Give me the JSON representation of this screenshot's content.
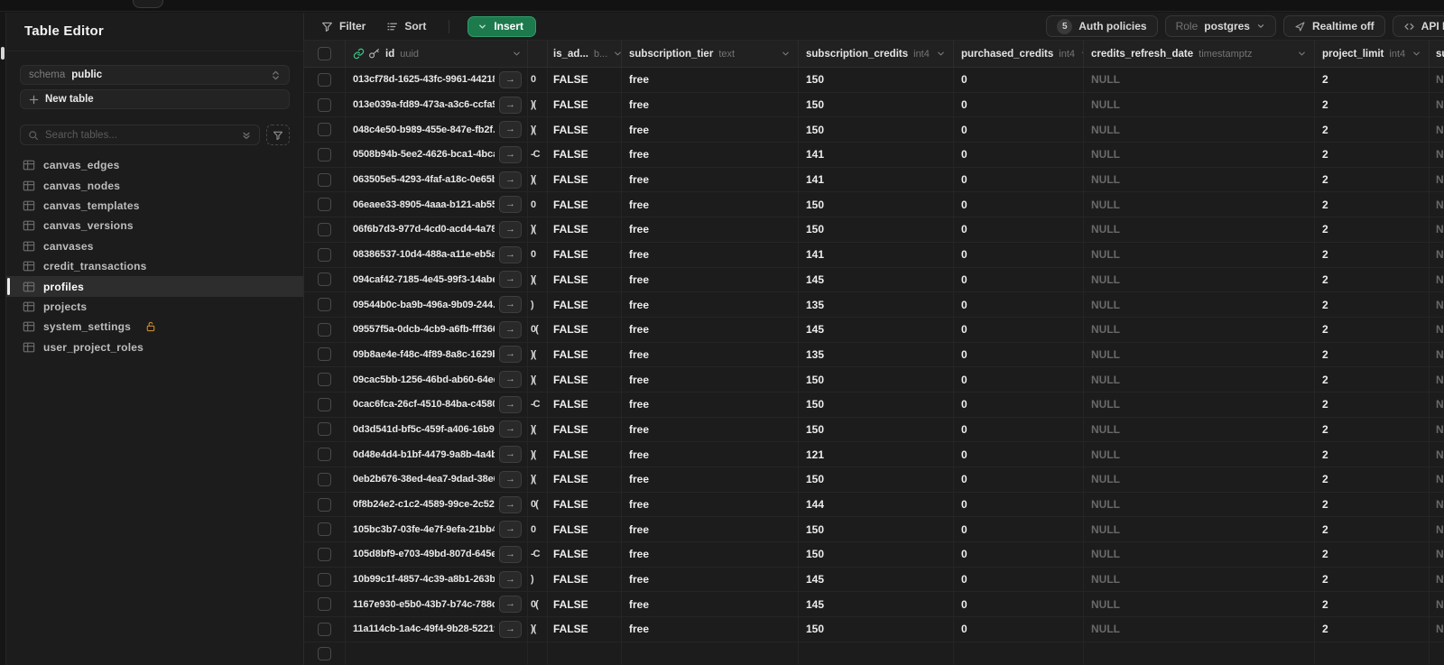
{
  "colors": {
    "brand_green": "#3ECF8E",
    "insert_button": "#1D7A4D",
    "lock_warning": "#C98A2C",
    "background": "#1C1C1C"
  },
  "sidebar": {
    "title": "Table Editor",
    "schema_label": "schema",
    "schema_value": "public",
    "new_table_label": "New table",
    "search_placeholder": "Search tables...",
    "tables": [
      {
        "label": "canvas_edges"
      },
      {
        "label": "canvas_nodes"
      },
      {
        "label": "canvas_templates"
      },
      {
        "label": "canvas_versions"
      },
      {
        "label": "canvases"
      },
      {
        "label": "credit_transactions"
      },
      {
        "label": "profiles",
        "selected": true
      },
      {
        "label": "projects"
      },
      {
        "label": "system_settings",
        "locked": true
      },
      {
        "label": "user_project_roles"
      }
    ]
  },
  "toolbar": {
    "filter_label": "Filter",
    "sort_label": "Sort",
    "insert_label": "Insert",
    "auth_policies_count": "5",
    "auth_policies_label": "Auth policies",
    "role_label": "Role",
    "role_value": "postgres",
    "realtime_label": "Realtime off",
    "api_docs_label": "API Do"
  },
  "grid": {
    "columns": [
      {
        "name": "id",
        "type": "uuid"
      },
      {
        "name": "",
        "type": ""
      },
      {
        "name": "is_ad...",
        "type": "b..."
      },
      {
        "name": "subscription_tier",
        "type": "text"
      },
      {
        "name": "subscription_credits",
        "type": "int4"
      },
      {
        "name": "purchased_credits",
        "type": "int4"
      },
      {
        "name": "credits_refresh_date",
        "type": "timestamptz"
      },
      {
        "name": "project_limit",
        "type": "int4"
      },
      {
        "name": "su",
        "type": ""
      }
    ],
    "row_fields": [
      "id",
      "fragment",
      "is_admin",
      "subscription_tier",
      "subscription_credits",
      "purchased_credits",
      "credits_refresh_date",
      "project_limit",
      "overflow"
    ],
    "rows": [
      [
        "013cf78d-1625-43fc-9961-442189...",
        "0",
        "FALSE",
        "free",
        "150",
        "0",
        "NULL",
        "2",
        "N"
      ],
      [
        "013e039a-fd89-473a-a3c6-ccfa9...",
        ")(",
        "FALSE",
        "free",
        "150",
        "0",
        "NULL",
        "2",
        "N"
      ],
      [
        "048c4e50-b989-455e-847e-fb2f...",
        ")(",
        "FALSE",
        "free",
        "150",
        "0",
        "NULL",
        "2",
        "N"
      ],
      [
        "0508b94b-5ee2-4626-bca1-4bca...",
        "-C",
        "FALSE",
        "free",
        "141",
        "0",
        "NULL",
        "2",
        "N"
      ],
      [
        "063505e5-4293-4faf-a18c-0e65b...",
        ")(",
        "FALSE",
        "free",
        "141",
        "0",
        "NULL",
        "2",
        "N"
      ],
      [
        "06eaee33-8905-4aaa-b121-ab552...",
        "0",
        "FALSE",
        "free",
        "150",
        "0",
        "NULL",
        "2",
        "N"
      ],
      [
        "06f6b7d3-977d-4cd0-acd4-4a78...",
        ")(",
        "FALSE",
        "free",
        "150",
        "0",
        "NULL",
        "2",
        "N"
      ],
      [
        "08386537-10d4-488a-a11e-eb5a6...",
        "0",
        "FALSE",
        "free",
        "141",
        "0",
        "NULL",
        "2",
        "N"
      ],
      [
        "094caf42-7185-4e45-99f3-14abee...",
        ")(",
        "FALSE",
        "free",
        "145",
        "0",
        "NULL",
        "2",
        "N"
      ],
      [
        "09544b0c-ba9b-496a-9b09-244...",
        ")",
        "FALSE",
        "free",
        "135",
        "0",
        "NULL",
        "2",
        "N"
      ],
      [
        "09557f5a-0dcb-4cb9-a6fb-fff366...",
        "0(",
        "FALSE",
        "free",
        "145",
        "0",
        "NULL",
        "2",
        "N"
      ],
      [
        "09b8ae4e-f48c-4f89-8a8c-1629b...",
        ")(",
        "FALSE",
        "free",
        "135",
        "0",
        "NULL",
        "2",
        "N"
      ],
      [
        "09cac5bb-1256-46bd-ab60-64ed...",
        ")(",
        "FALSE",
        "free",
        "150",
        "0",
        "NULL",
        "2",
        "N"
      ],
      [
        "0cac6fca-26cf-4510-84ba-c4580...",
        "-C",
        "FALSE",
        "free",
        "150",
        "0",
        "NULL",
        "2",
        "N"
      ],
      [
        "0d3d541d-bf5c-459f-a406-16b93...",
        ")(",
        "FALSE",
        "free",
        "150",
        "0",
        "NULL",
        "2",
        "N"
      ],
      [
        "0d48e4d4-b1bf-4479-9a8b-4a4b...",
        ")(",
        "FALSE",
        "free",
        "121",
        "0",
        "NULL",
        "2",
        "N"
      ],
      [
        "0eb2b676-38ed-4ea7-9dad-38e6...",
        ")(",
        "FALSE",
        "free",
        "150",
        "0",
        "NULL",
        "2",
        "N"
      ],
      [
        "0f8b24e2-c1c2-4589-99ce-2c52d...",
        "0(",
        "FALSE",
        "free",
        "144",
        "0",
        "NULL",
        "2",
        "N"
      ],
      [
        "105bc3b7-03fe-4e7f-9efa-21bb40...",
        "0",
        "FALSE",
        "free",
        "150",
        "0",
        "NULL",
        "2",
        "N"
      ],
      [
        "105d8bf9-e703-49bd-807d-645e...",
        "-C",
        "FALSE",
        "free",
        "150",
        "0",
        "NULL",
        "2",
        "N"
      ],
      [
        "10b99c1f-4857-4c39-a8b1-263b8...",
        ")",
        "FALSE",
        "free",
        "145",
        "0",
        "NULL",
        "2",
        "N"
      ],
      [
        "1167e930-e5b0-43b7-b74c-788c9...",
        "0(",
        "FALSE",
        "free",
        "145",
        "0",
        "NULL",
        "2",
        "N"
      ],
      [
        "11a114cb-1a4c-49f4-9b28-52219ec...",
        ")(",
        "FALSE",
        "free",
        "150",
        "0",
        "NULL",
        "2",
        "N"
      ]
    ]
  }
}
